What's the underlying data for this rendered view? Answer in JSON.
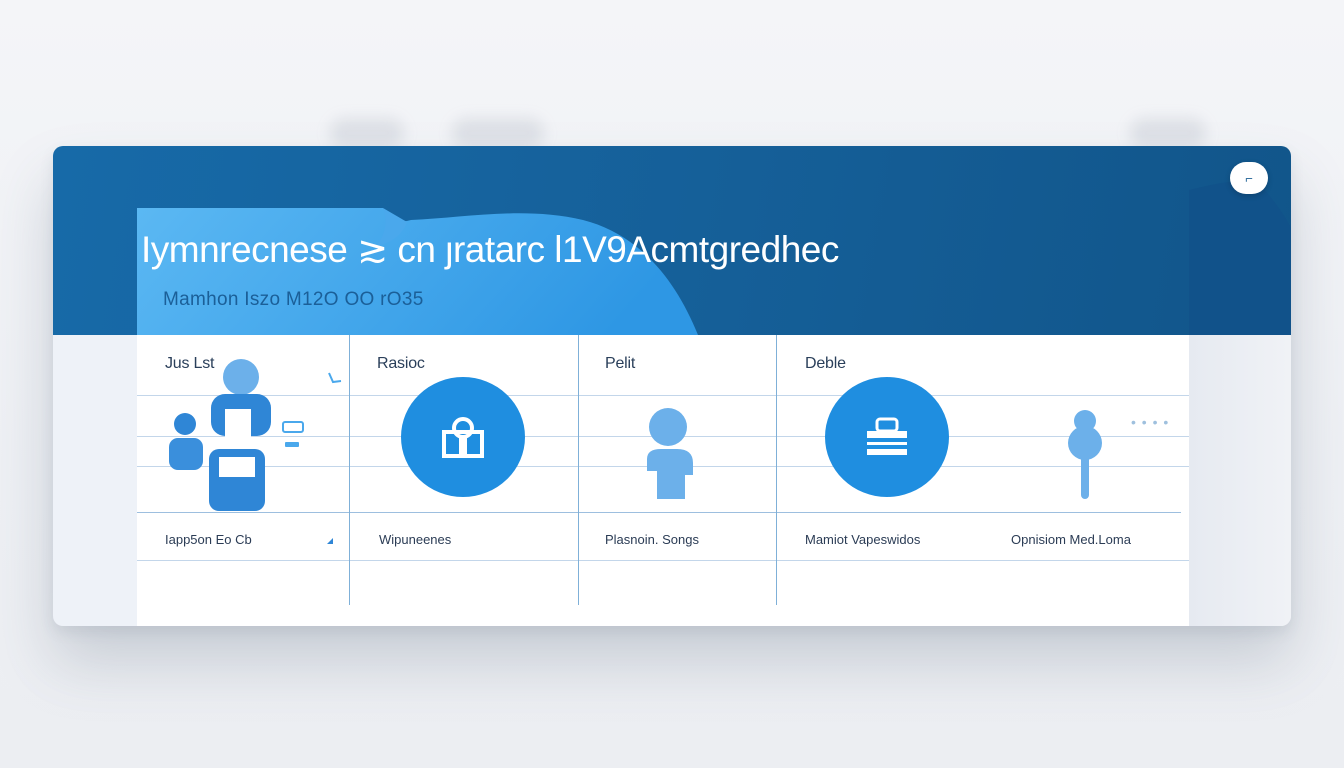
{
  "app": {
    "title": "Iymnrecnese ≳ cn ȷratarc l1V9Acmtgredhec",
    "subtitle": "Mamhon  Iszo  M12O  OO  rO35"
  },
  "header": {
    "menu_button_label": "⌐"
  },
  "columns": [
    {
      "header": "Jus  Lst",
      "label": "Iapp5on  Eo  Cb",
      "icon": "group-of-people-icon"
    },
    {
      "header": "Rasioc",
      "label": "Wipuneenes",
      "icon": "building-icon"
    },
    {
      "header": "Pelit",
      "label": "Plasnoin. Songs",
      "icon": "person-icon"
    },
    {
      "header": "Deble",
      "label": "Mamiot  Vapeswidos",
      "icon": "document-icon"
    },
    {
      "header": "",
      "label": "Opnisiom  Med.Loma",
      "icon": "key-icon"
    }
  ],
  "colors": {
    "header_blue": "#176aa8",
    "wave_blue": "#47aef0",
    "accent_blue": "#1f8ee0",
    "icon_light_blue": "#6cb0ea",
    "icon_mid_blue": "#2f86d6",
    "panel_white": "#ffffff",
    "row_line": "#c3d6ea"
  }
}
